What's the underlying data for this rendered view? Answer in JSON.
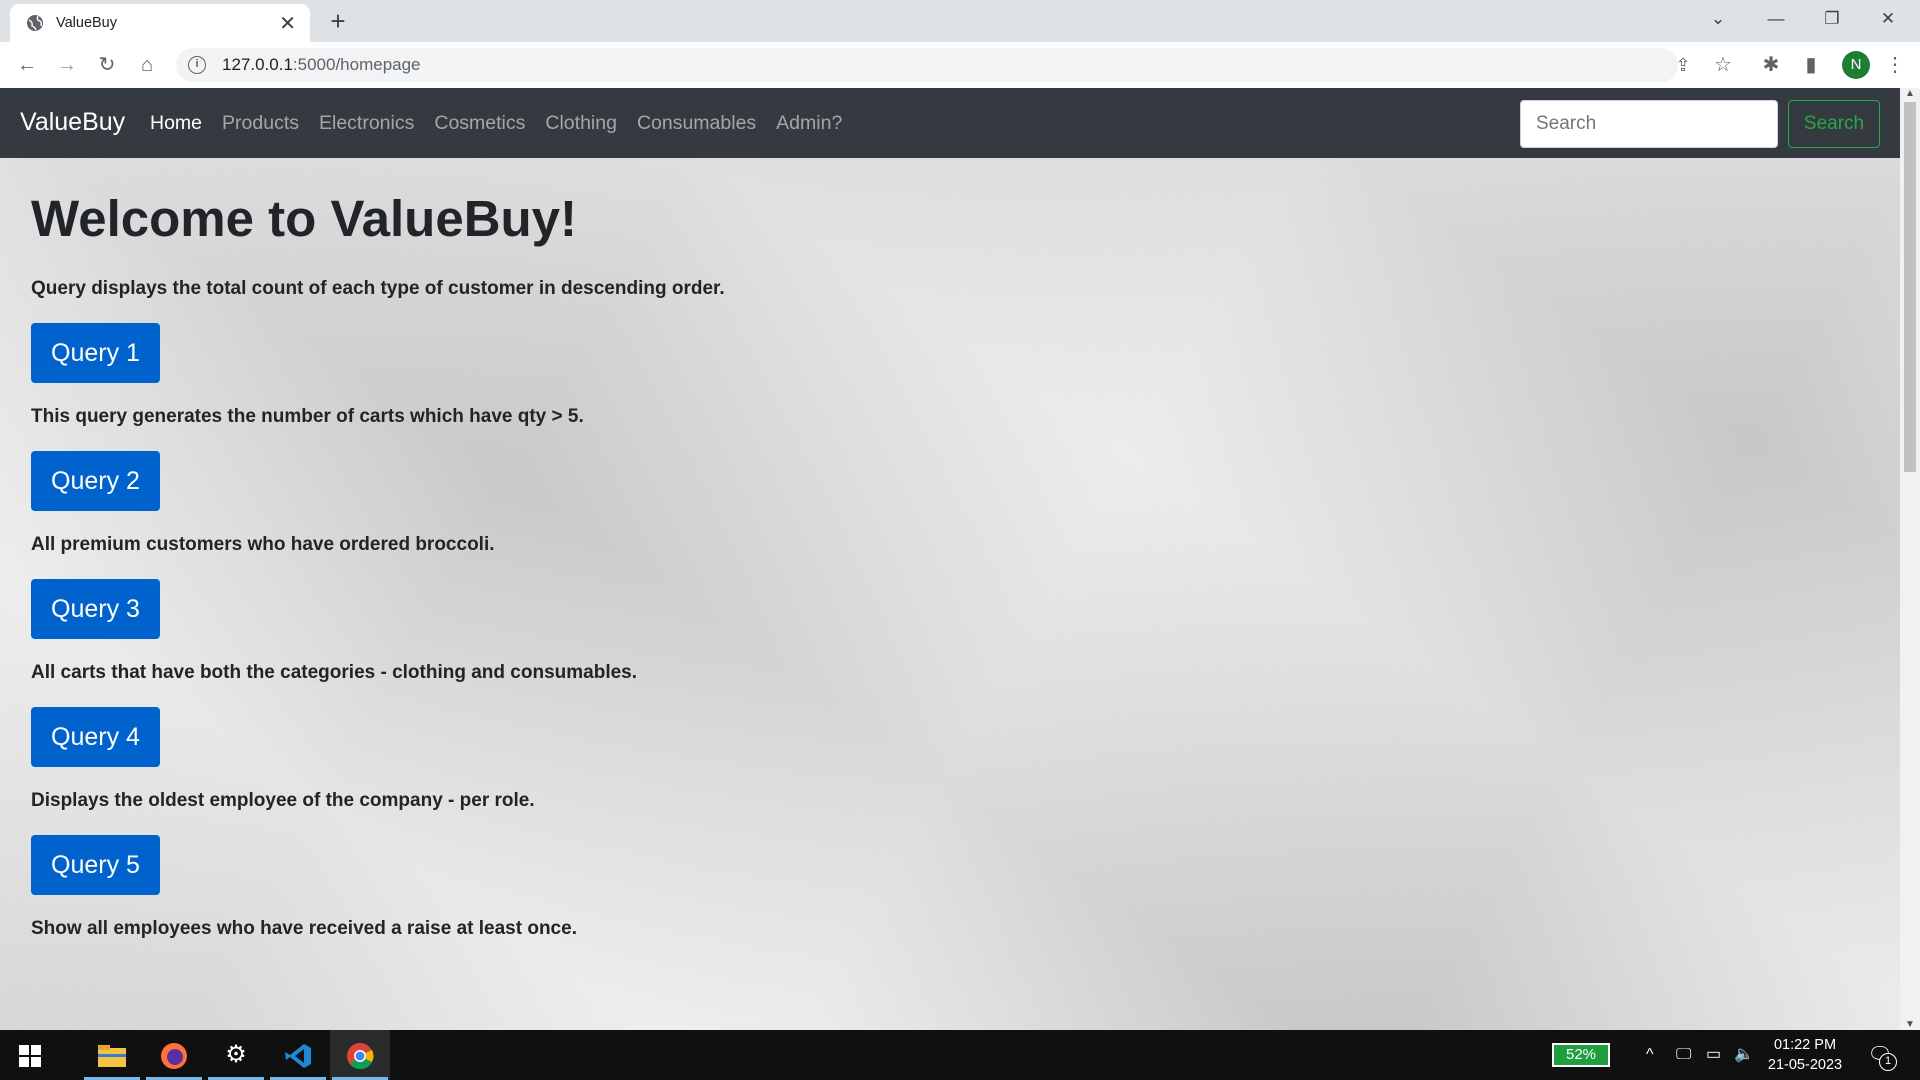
{
  "browser": {
    "tab_title": "ValueBuy",
    "url_host": "127.0.0.1",
    "url_rest": ":5000/homepage",
    "profile_initial": "N"
  },
  "navbar": {
    "brand": "ValueBuy",
    "links": [
      "Home",
      "Products",
      "Electronics",
      "Cosmetics",
      "Clothing",
      "Consumables",
      "Admin?"
    ],
    "active_link": "Home",
    "search_placeholder": "Search",
    "search_button": "Search"
  },
  "main": {
    "heading": "Welcome to ValueBuy!",
    "queries": [
      {
        "description": "Query displays the total count of each type of customer in descending order.",
        "button": "Query 1"
      },
      {
        "description": "This query generates the number of carts which have qty > 5.",
        "button": "Query 2"
      },
      {
        "description": "All premium customers who have ordered broccoli.",
        "button": "Query 3"
      },
      {
        "description": "All carts that have both the categories - clothing and consumables.",
        "button": "Query 4"
      },
      {
        "description": "Displays the oldest employee of the company - per role.",
        "button": "Query 5"
      },
      {
        "description": "Show all employees who have received a raise at least once.",
        "button": ""
      }
    ]
  },
  "taskbar": {
    "battery": "52%",
    "time": "01:22 PM",
    "date": "21-05-2023",
    "notification_count": "1"
  },
  "colors": {
    "navbar_bg": "#343a40",
    "primary_button": "#0062cc",
    "search_outline": "#28a745"
  }
}
